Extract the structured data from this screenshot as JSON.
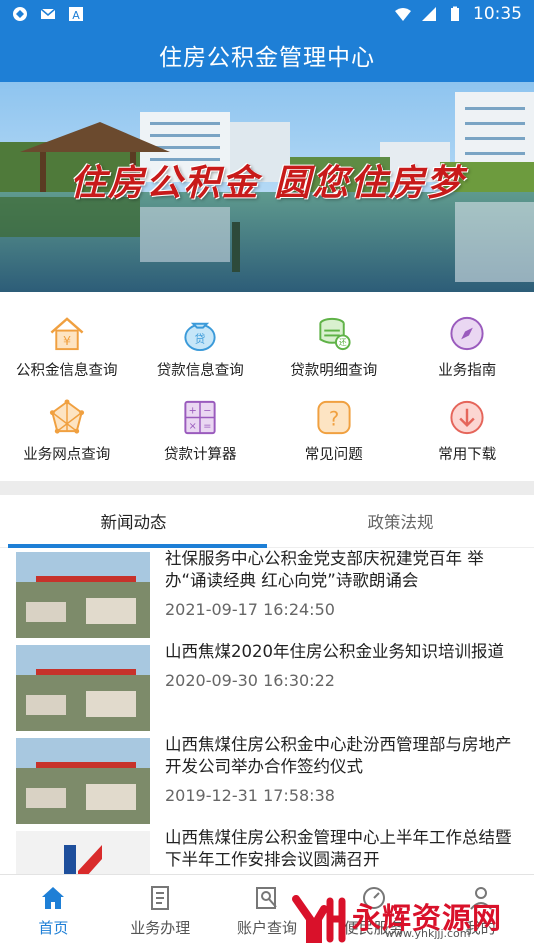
{
  "status_bar": {
    "time": "10:35"
  },
  "header": {
    "title": "住房公积金管理中心"
  },
  "banner": {
    "slogan": "住房公积金 圆您住房梦"
  },
  "services": [
    {
      "label": "公积金信息查询",
      "icon": "house-yuan-icon"
    },
    {
      "label": "贷款信息查询",
      "icon": "money-bag-icon"
    },
    {
      "label": "贷款明细查询",
      "icon": "coin-stack-icon"
    },
    {
      "label": "业务指南",
      "icon": "compass-icon"
    },
    {
      "label": "业务网点查询",
      "icon": "network-icon"
    },
    {
      "label": "贷款计算器",
      "icon": "calculator-icon"
    },
    {
      "label": "常见问题",
      "icon": "question-icon"
    },
    {
      "label": "常用下载",
      "icon": "download-icon"
    }
  ],
  "tabs": [
    {
      "label": "新闻动态",
      "active": true
    },
    {
      "label": "政策法规",
      "active": false
    }
  ],
  "news": [
    {
      "title": "社保服务中心公积金党支部庆祝建党百年 举办“诵读经典 红心向党”诗歌朗诵会",
      "date": "2021-09-17 16:24:50"
    },
    {
      "title": "山西焦煤2020年住房公积金业务知识培训报道",
      "date": "2020-09-30 16:30:22"
    },
    {
      "title": "山西焦煤住房公积金中心赴汾西管理部与房地产开发公司举办合作签约仪式",
      "date": "2019-12-31 17:58:38"
    },
    {
      "title": "山西焦煤住房公积金管理中心上半年工作总结暨下半年工作安排会议圆满召开",
      "date": ""
    }
  ],
  "bottom_nav": [
    {
      "label": "首页",
      "icon": "home-icon",
      "active": true
    },
    {
      "label": "业务办理",
      "icon": "document-icon",
      "active": false
    },
    {
      "label": "账户查询",
      "icon": "account-search-icon",
      "active": false
    },
    {
      "label": "便民服务",
      "icon": "service-icon",
      "active": false
    },
    {
      "label": "我的",
      "icon": "user-icon",
      "active": false
    }
  ],
  "watermark": {
    "text": "永辉资源网",
    "url": "www.yhkjjj.com"
  },
  "colors": {
    "primary": "#1e7fd6",
    "orange": "#f0a040",
    "red_slogan": "#c81a1a",
    "watermark_red": "#d9112a"
  }
}
